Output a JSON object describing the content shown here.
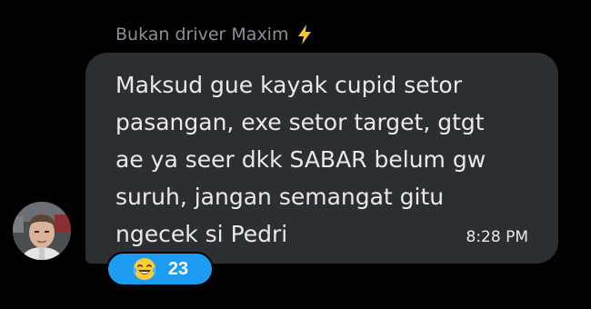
{
  "message": {
    "sender_name": "Bukan driver Maxim",
    "sender_badge_icon": "lightning-bolt-icon",
    "text": "Maksud gue kayak cupid setor\npasangan, exe setor target, gtgt\nae ya seer dkk SABAR belum gw\nsuruh, jangan semangat gitu\nngecek si Pedri",
    "time": "8:28 PM",
    "reaction": {
      "emoji_icon": "face-with-tears-of-joy-icon",
      "count": "23"
    }
  },
  "colors": {
    "background": "#000000",
    "bubble": "#2c2f32",
    "text": "#e7e9ea",
    "sender": "#8b9096",
    "reaction": "#1d9bf0",
    "bolt": "#f4c430"
  }
}
